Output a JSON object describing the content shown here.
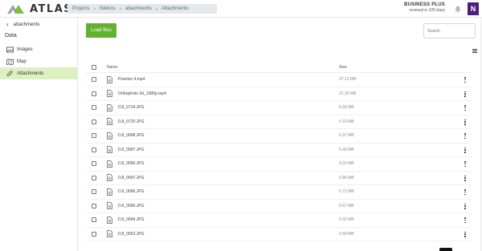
{
  "app": {
    "name": "ATLAS",
    "logo_colors": {
      "green": "#7cc142",
      "gray": "#9aa3a8"
    }
  },
  "breadcrumb": [
    "Projects",
    "Nikinos",
    "attachments",
    "Attachments"
  ],
  "plan": {
    "name": "BUSINESS PLUS",
    "renewal": "renewal in 220 days"
  },
  "user": {
    "initial": "N",
    "color": "#4a1e7a"
  },
  "sidebar": {
    "back_label": "attachments",
    "section": "Data",
    "items": [
      {
        "label": "Images",
        "icon": "images-icon",
        "active": false
      },
      {
        "label": "Map",
        "icon": "map-icon",
        "active": false
      },
      {
        "label": "Attachments",
        "icon": "paperclip-icon",
        "active": true
      }
    ]
  },
  "toolbar": {
    "load_label": "Load files",
    "search_placeholder": "Search"
  },
  "table": {
    "columns": [
      "Name",
      "Size"
    ],
    "rows": [
      {
        "name": "Practice 4.mp4",
        "size": "37.13 MB"
      },
      {
        "name": "Orthophoto 3d_1080p.mp4",
        "size": "31.35 MB"
      },
      {
        "name": "DJI_0724.JPG",
        "size": "5.58 MB"
      },
      {
        "name": "DJI_0720.JPG",
        "size": "5.33 MB"
      },
      {
        "name": "DJI_0688.JPG",
        "size": "5.37 MB"
      },
      {
        "name": "DJI_0687.JPG",
        "size": "5.48 MB"
      },
      {
        "name": "DJI_0686.JPG",
        "size": "5.03 MB"
      },
      {
        "name": "DJI_0687.JPG",
        "size": "5.86 MB"
      },
      {
        "name": "DJI_0686.JPG",
        "size": "5.72 MB"
      },
      {
        "name": "DJI_0685.JPG",
        "size": "5.67 MB"
      },
      {
        "name": "DJI_0684.JPG",
        "size": "5.92 MB"
      },
      {
        "name": "DJI_0663.JPG",
        "size": "5.58 MB"
      }
    ]
  }
}
